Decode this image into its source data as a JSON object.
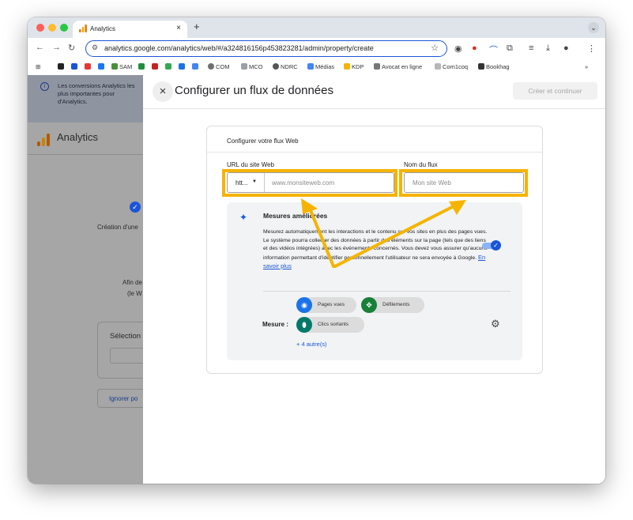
{
  "browser": {
    "tab_title": "Analytics",
    "tab_close": "×",
    "new_tab": "+",
    "tab_menu": "⌄",
    "url": "analytics.google.com/analytics/web/#/a324816156p453823281/admin/property/create",
    "bookmarks": [
      "SAM",
      "COM",
      "MCO",
      "NDRC",
      "Médias",
      "KDP",
      "Avocat en ligne",
      "Com1coq",
      "Bookhag"
    ],
    "bookmark_more": "»"
  },
  "left_panel": {
    "banner_text": "Les conversions Analytics les plus importantes pour d'Analytics.",
    "app_title": "Analytics",
    "step_label": "Création d'une",
    "info_line1": "Afin de",
    "info_line2": "(le W",
    "select_title": "Sélection",
    "ignore_button": "Ignorer po"
  },
  "dialog": {
    "title": "Configurer un flux de données",
    "create_button": "Créer et continuer",
    "card_title": "Configurer votre flux Web",
    "url_label": "URL du site Web",
    "protocol_value": "htt...",
    "url_placeholder": "www.monsiteweb.com",
    "name_label": "Nom du flux",
    "name_placeholder": "Mon site Web",
    "enhanced": {
      "title": "Mesures améliorées",
      "desc1": "Mesurez automatiquement les interactions et le contenu sur vos sites en plus des pages vues.",
      "desc2": "Le système pourra collecter des données à partir des éléments sur la page (tels que des liens et des vidéos intégrées) avec les événements concernés. Vous devez vous assurer qu'aucune information permettant d'identifier personnellement l'utilisateur ne sera envoyée à Google.",
      "learn_more": "En savoir plus",
      "toggle_on": true,
      "measure_label": "Mesure :",
      "chips": [
        "Pages vues",
        "Défilements",
        "Clics sortants"
      ],
      "more": "+ 4 autre(s)"
    }
  },
  "colors": {
    "accent": "#1a55d8",
    "highlight": "#f5b400",
    "overlay": "#a6a6a6"
  }
}
